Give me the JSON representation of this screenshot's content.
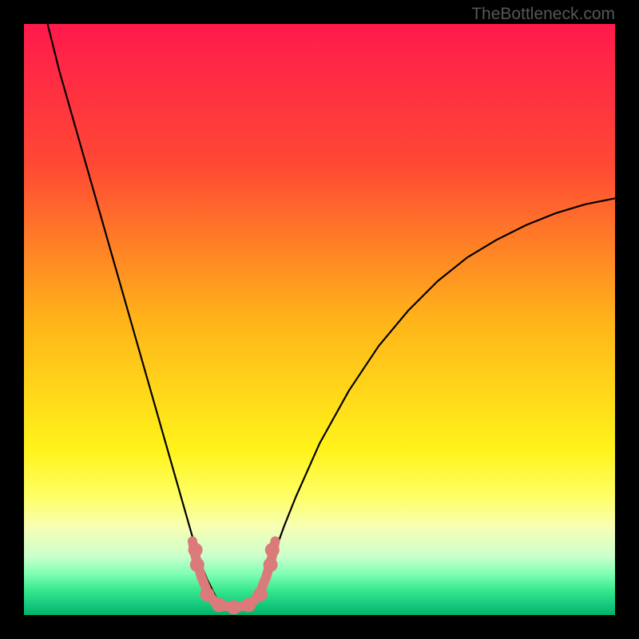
{
  "watermark": "TheBottleneck.com",
  "chart_data": {
    "type": "line",
    "title": "",
    "xlabel": "",
    "ylabel": "",
    "xlim": [
      0,
      100
    ],
    "ylim": [
      0,
      100
    ],
    "background_gradient_stops": [
      {
        "pos": 0.0,
        "color": "#ff1a4d"
      },
      {
        "pos": 0.24,
        "color": "#ff4934"
      },
      {
        "pos": 0.5,
        "color": "#ffb31a"
      },
      {
        "pos": 0.72,
        "color": "#fff31a"
      },
      {
        "pos": 0.8,
        "color": "#ffff66"
      },
      {
        "pos": 0.85,
        "color": "#f7ffb3"
      },
      {
        "pos": 0.9,
        "color": "#ccffcc"
      },
      {
        "pos": 0.93,
        "color": "#80ffb3"
      },
      {
        "pos": 0.96,
        "color": "#33e68c"
      },
      {
        "pos": 0.98,
        "color": "#1acc80"
      },
      {
        "pos": 1.0,
        "color": "#00b366"
      }
    ],
    "series": [
      {
        "name": "left-branch",
        "stroke": "#000000",
        "x": [
          4.0,
          6.0,
          8.0,
          10.0,
          12.0,
          14.0,
          16.0,
          18.0,
          20.0,
          22.0,
          24.0,
          26.0,
          28.0,
          29.0,
          30.0,
          31.0,
          32.0,
          33.0
        ],
        "y": [
          100.0,
          92.0,
          85.0,
          78.0,
          71.0,
          64.0,
          57.0,
          50.0,
          43.0,
          36.0,
          29.0,
          22.0,
          15.0,
          11.5,
          8.5,
          6.0,
          4.0,
          2.0
        ]
      },
      {
        "name": "right-branch",
        "stroke": "#000000",
        "x": [
          39.0,
          40.0,
          41.0,
          42.0,
          44.0,
          46.0,
          50.0,
          55.0,
          60.0,
          65.0,
          70.0,
          75.0,
          80.0,
          85.0,
          90.0,
          95.0,
          100.0
        ],
        "y": [
          2.0,
          4.0,
          6.5,
          9.5,
          15.0,
          20.0,
          29.0,
          38.0,
          45.5,
          51.5,
          56.5,
          60.5,
          63.5,
          66.0,
          68.0,
          69.5,
          70.5
        ]
      },
      {
        "name": "bottom-track",
        "stroke": "#db7a7a",
        "x": [
          28.5,
          29.0,
          30.0,
          31.0,
          32.0,
          33.0,
          34.0,
          35.0,
          36.0,
          37.0,
          38.0,
          39.0,
          40.0,
          41.0,
          42.0,
          42.5
        ],
        "y": [
          12.5,
          10.0,
          6.5,
          4.0,
          2.5,
          1.8,
          1.5,
          1.4,
          1.4,
          1.5,
          1.8,
          2.5,
          4.0,
          6.5,
          10.0,
          12.5
        ]
      }
    ],
    "dots": {
      "name": "bottom-markers",
      "color": "#db7a7a",
      "radius": 9,
      "points": [
        {
          "x": 29.0,
          "y": 11.0
        },
        {
          "x": 29.3,
          "y": 8.5
        },
        {
          "x": 31.0,
          "y": 3.5
        },
        {
          "x": 33.0,
          "y": 1.7
        },
        {
          "x": 35.5,
          "y": 1.3
        },
        {
          "x": 38.0,
          "y": 1.7
        },
        {
          "x": 40.0,
          "y": 3.5
        },
        {
          "x": 41.7,
          "y": 8.5
        },
        {
          "x": 42.0,
          "y": 11.0
        }
      ]
    }
  }
}
